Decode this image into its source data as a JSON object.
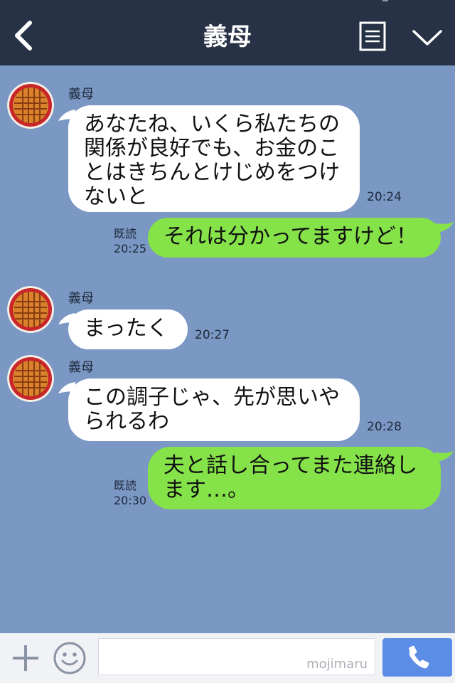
{
  "header": {
    "title": "義母",
    "bg_color": "#273246"
  },
  "chat": {
    "bg_color": "#7b97c4",
    "messages": [
      {
        "sender": "義母",
        "text_lines": [
          "あなたね、いくら私たちの",
          "関係が良好でも、お金のこ",
          "とはきちんとけじめをつけ",
          "ないと"
        ],
        "time": "20:24"
      },
      {
        "read": "既読",
        "time": "20:25",
        "text": "それは分かってますけど！"
      },
      {
        "sender": "義母",
        "text": "まったく",
        "time": "20:27"
      },
      {
        "sender": "義母",
        "text_lines": [
          "この調子じゃ、先が思いや",
          "られるわ"
        ],
        "time": "20:28"
      },
      {
        "read": "既読",
        "time": "20:30",
        "text_lines": [
          "夫と話し合ってまた連絡し",
          "ます…。"
        ]
      }
    ],
    "incoming_bubble_color": "#ffffff",
    "outgoing_bubble_color": "#85e249"
  },
  "inputbar": {
    "watermark": "mojimaru",
    "send_color": "#5c8de6"
  },
  "icons": [
    "back-icon",
    "menu-icon",
    "chevron-down-icon",
    "plus-icon",
    "smiley-icon",
    "phone-icon",
    "pie-avatar-icon"
  ]
}
